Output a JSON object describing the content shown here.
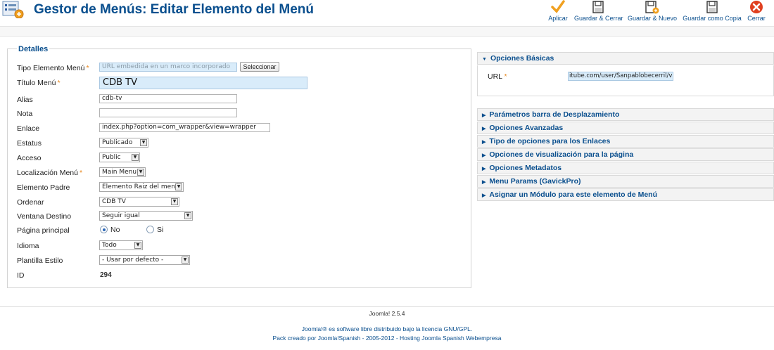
{
  "header": {
    "title": "Gestor de Menús: Editar Elemento del Menú",
    "toolbar": [
      {
        "name": "apply",
        "label": "Aplicar",
        "icon": "checkmark-icon"
      },
      {
        "name": "save-close",
        "label": "Guardar & Cerrar",
        "icon": "save-icon"
      },
      {
        "name": "save-new",
        "label": "Guardar & Nuevo",
        "icon": "save-new-icon"
      },
      {
        "name": "save-copy",
        "label": "Guardar como Copia",
        "icon": "save-copy-icon"
      },
      {
        "name": "close",
        "label": "Cerrar",
        "icon": "close-icon"
      }
    ]
  },
  "details": {
    "legend": "Detalles",
    "menu_type": {
      "label": "Tipo Elemento Menú",
      "placeholder": "URL embedida en un marco incorporado",
      "button": "Seleccionar"
    },
    "title": {
      "label": "Título Menú",
      "value": "CDB TV"
    },
    "alias": {
      "label": "Alias",
      "value": "cdb-tv"
    },
    "note": {
      "label": "Nota",
      "value": ""
    },
    "link": {
      "label": "Enlace",
      "value": "index.php?option=com_wrapper&view=wrapper"
    },
    "status": {
      "label": "Estatus",
      "value": "Publicado"
    },
    "access": {
      "label": "Acceso",
      "value": "Public"
    },
    "menu_location": {
      "label": "Localización Menú",
      "value": "Main Menu"
    },
    "parent": {
      "label": "Elemento Padre",
      "value": "Elemento Raiz del menú"
    },
    "order": {
      "label": "Ordenar",
      "value": "CDB TV"
    },
    "target": {
      "label": "Ventana Destino",
      "value": "Seguir igual"
    },
    "home": {
      "label": "Página principal",
      "no": "No",
      "yes": "Si",
      "selected": "No"
    },
    "language": {
      "label": "Idioma",
      "value": "Todo"
    },
    "template": {
      "label": "Plantilla Estilo",
      "value": "- Usar por defecto -"
    },
    "id": {
      "label": "ID",
      "value": "294"
    }
  },
  "options": {
    "basic": {
      "title": "Opciones Básicas",
      "url_label": "URL",
      "url_value": "itube.com/user/Sanpablobecerril/videos"
    },
    "sections": [
      "Parámetros barra de Desplazamiento",
      "Opciones Avanzadas",
      "Tipo de opciones para los Enlaces",
      "Opciones de visualización para la página",
      "Opciones Metadatos",
      "Menu Params (GavickPro)",
      "Asignar un Módulo para este elemento de Menú"
    ]
  },
  "footer": {
    "version": "Joomla! 2.5.4",
    "license": "Joomla!® es software libre distribuido bajo la licencia GNU/GPL.",
    "credits": "Pack creado por Joomla!Spanish - 2005-2012 - Hosting Joomla Spanish Webempresa"
  },
  "colors": {
    "accent": "#0a4f8e",
    "required": "#e8871e",
    "field_highlight": "#d9ecfa"
  }
}
